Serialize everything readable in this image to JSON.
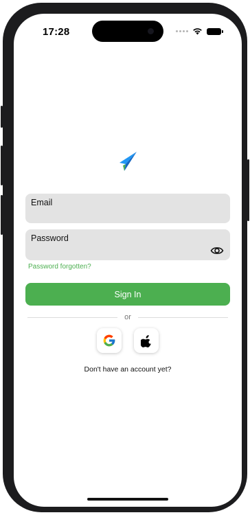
{
  "status_bar": {
    "time": "17:28",
    "icons": [
      "signal-dots-icon",
      "wifi-icon",
      "battery-icon"
    ]
  },
  "logo": {
    "icon": "paper-plane-icon",
    "colors": [
      "#1565c0",
      "#2196f3",
      "#4caf50"
    ]
  },
  "login": {
    "email_label": "Email",
    "email_value": "",
    "password_label": "Password",
    "password_value": "",
    "password_toggle_icon": "eye-icon",
    "forgot_password": "Password forgotten?",
    "sign_in": "Sign In",
    "divider_text": "or",
    "social_buttons": [
      "google-icon",
      "apple-icon"
    ],
    "signup_prompt": "Don't have an account yet?"
  },
  "colors": {
    "accent": "#4caf50",
    "field_background": "#e3e3e3"
  }
}
